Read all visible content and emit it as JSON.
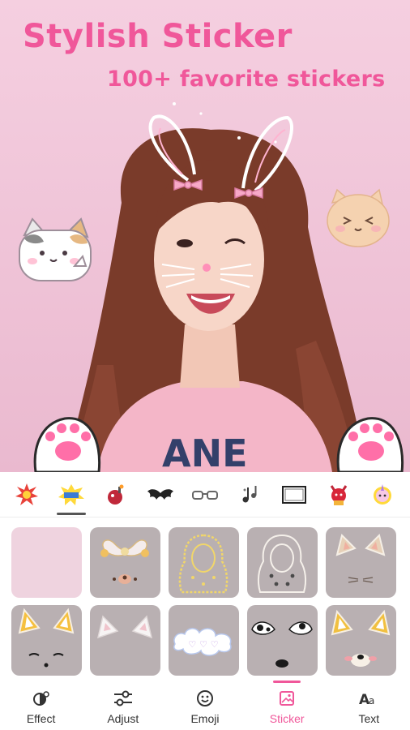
{
  "hero": {
    "title": "Stylish Sticker",
    "subtitle": "100+ favorite stickers"
  },
  "category_icons": [
    "boom-sticker-icon",
    "pow-sticker-icon",
    "bomb-sticker-icon",
    "bat-wings-icon",
    "glasses-icon",
    "music-notes-icon",
    "photo-frame-icon",
    "devil-sticker-icon",
    "unicorn-sticker-icon"
  ],
  "active_category_index": 1,
  "sticker_tiles": [
    "blank",
    "bear-bow-sticker",
    "yellow-hood-sticker",
    "hood-outline-sticker",
    "cat-ears-sticker",
    "fox-ears-sticker",
    "white-cat-ears-sticker",
    "cloud-text-sticker",
    "cow-ears-sticker",
    "dog-ears-sticker"
  ],
  "nav": {
    "effect": "Effect",
    "adjust": "Adjust",
    "emoji": "Emoji",
    "sticker": "Sticker",
    "text": "Text",
    "active": "Sticker"
  },
  "colors": {
    "accent": "#f0579a",
    "hero_bg": "#f3c7da",
    "tile_bg": "#b9b0b2"
  }
}
